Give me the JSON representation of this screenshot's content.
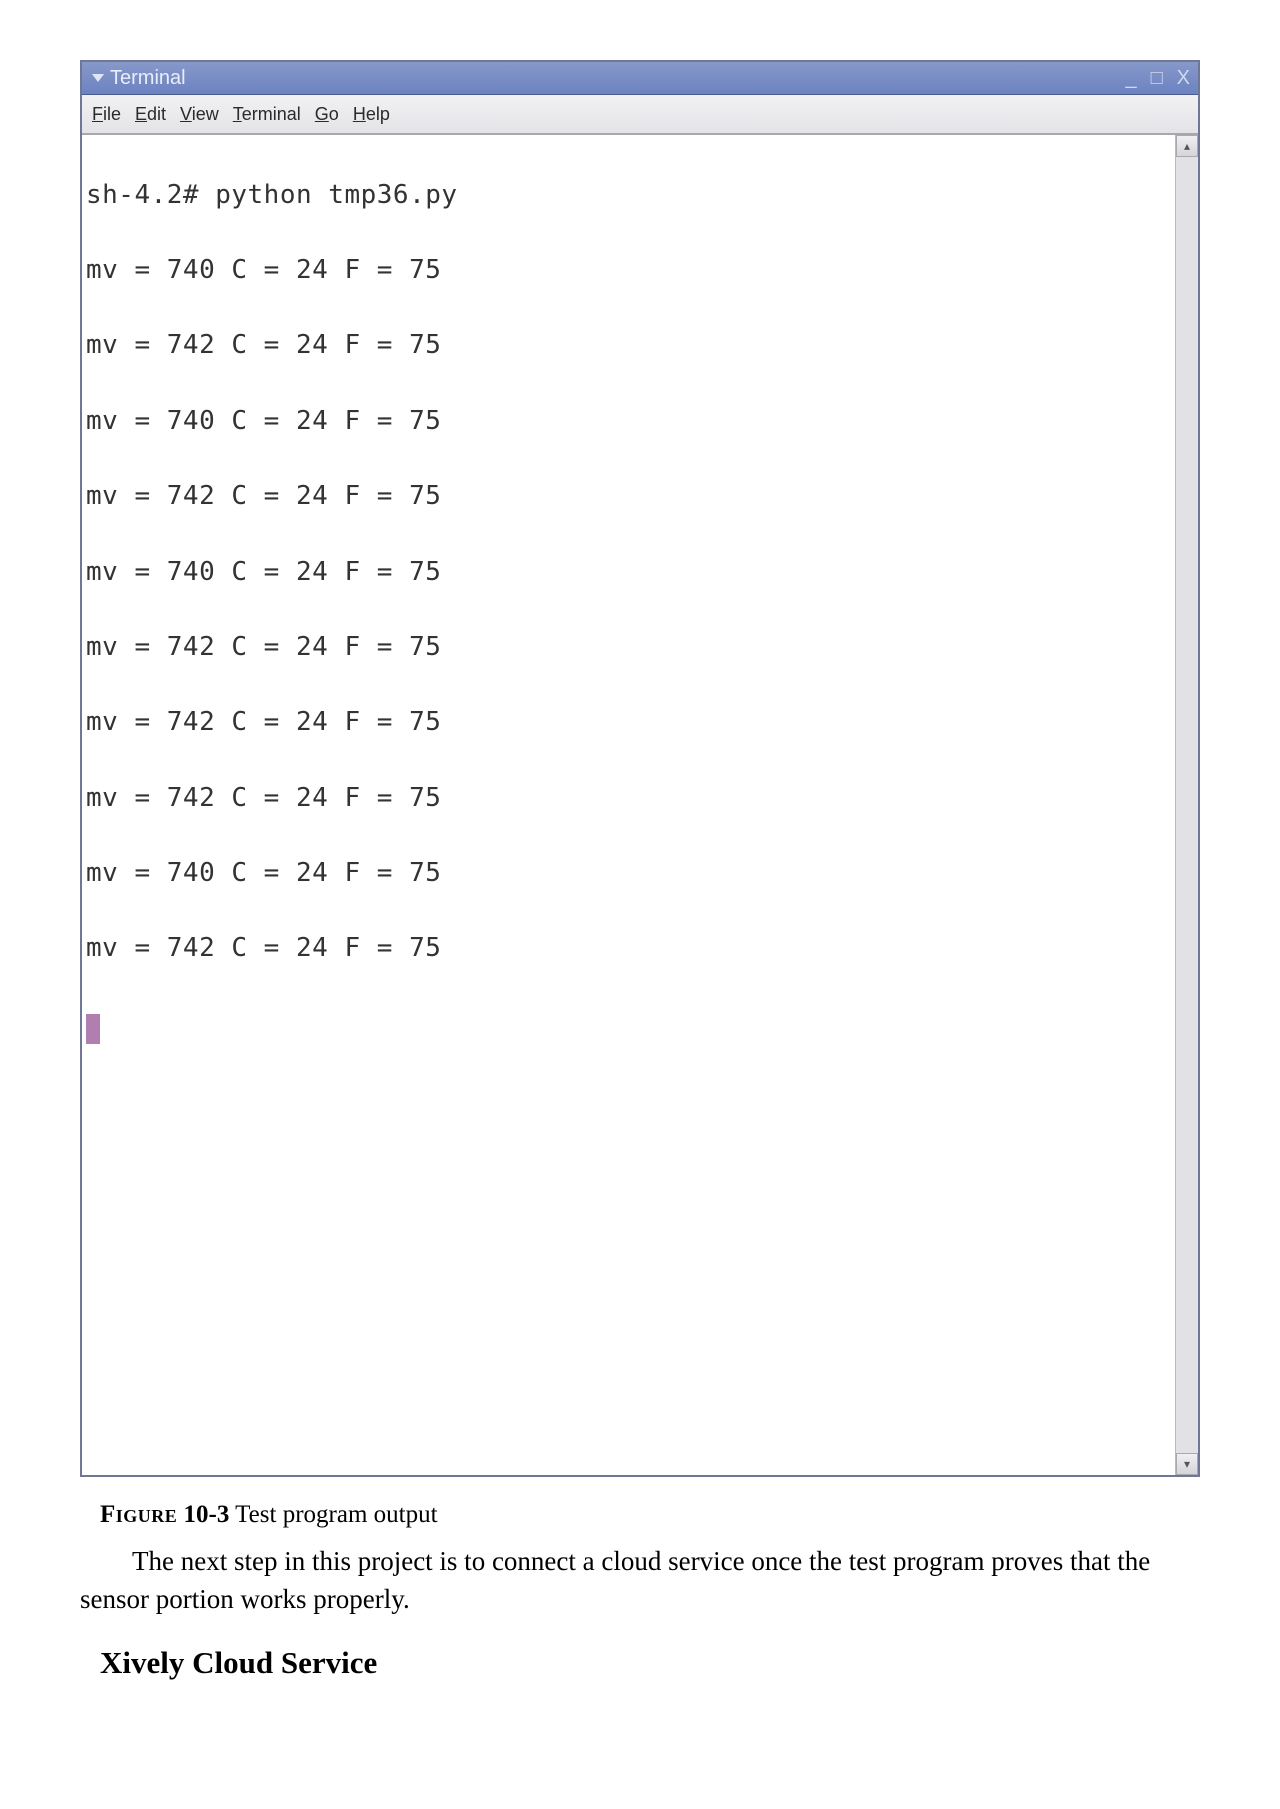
{
  "terminal": {
    "title": "Terminal",
    "window_controls": {
      "minimize": "_",
      "maximize": "□",
      "close": "X"
    },
    "menu": {
      "file_u": "F",
      "file_rest": "ile",
      "edit_u": "E",
      "edit_rest": "dit",
      "view_u": "V",
      "view_rest": "iew",
      "terminal_u": "T",
      "terminal_rest": "erminal",
      "go_u": "G",
      "go_rest": "o",
      "help_u": "H",
      "help_rest": "elp"
    },
    "scroll_up_glyph": "▴",
    "scroll_down_glyph": "▾",
    "lines": {
      "l0": "sh-4.2# python tmp36.py",
      "l1": "mv = 740 C = 24 F = 75",
      "l2": "mv = 742 C = 24 F = 75",
      "l3": "mv = 740 C = 24 F = 75",
      "l4": "mv = 742 C = 24 F = 75",
      "l5": "mv = 740 C = 24 F = 75",
      "l6": "mv = 742 C = 24 F = 75",
      "l7": "mv = 742 C = 24 F = 75",
      "l8": "mv = 742 C = 24 F = 75",
      "l9": "mv = 740 C = 24 F = 75",
      "l10": "mv = 742 C = 24 F = 75"
    }
  },
  "caption": {
    "label": "Figure",
    "number": "10-3",
    "text": " Test program output"
  },
  "paragraph": "The next step in this project is to connect a cloud service once the test program proves that the sensor portion works properly.",
  "heading": "Xively Cloud Service"
}
